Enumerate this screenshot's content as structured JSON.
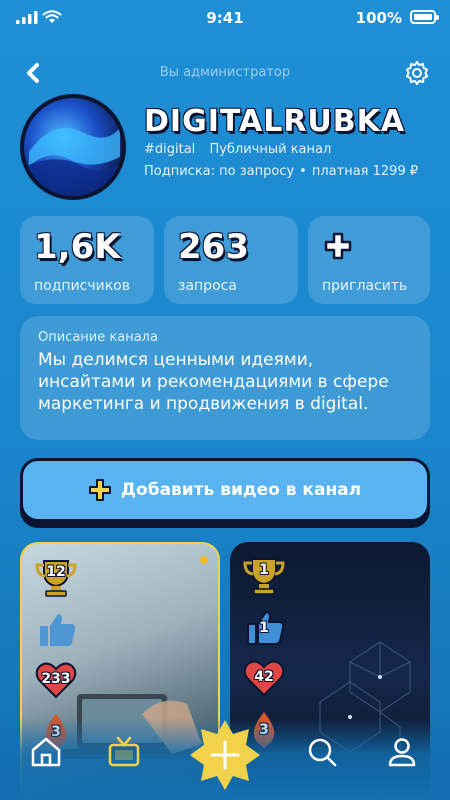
{
  "status": {
    "time": "9:41",
    "battery": "100%"
  },
  "header": {
    "admin_label": "Вы администратор"
  },
  "channel": {
    "name": "DIGITALRUBKA",
    "tag": "#digital",
    "type": "Публичный канал",
    "subscription_label": "Подписка:",
    "subscription_mode": "по запросу",
    "paid_label": "платная",
    "price": "1299 ₽"
  },
  "stats": [
    {
      "value": "1,6K",
      "label": "подписчиков"
    },
    {
      "value": "263",
      "label": "запроса"
    },
    {
      "value": "+",
      "label": "пригласить"
    }
  ],
  "description": {
    "title": "Описание канала",
    "text": "Мы делимся ценными идеями, инсайтами и рекомендациями в сфере маркетинга и продвижения в digital."
  },
  "add_video": {
    "label": "Добавить видео в канал"
  },
  "videos": [
    {
      "trophy": "12",
      "likes": "",
      "hearts": "233",
      "fire": "3"
    },
    {
      "trophy": "1",
      "likes": "1",
      "hearts": "42",
      "fire": "3"
    }
  ],
  "icons": {
    "back": "back-arrow-icon",
    "settings": "gear-icon",
    "home": "home-icon",
    "tv": "tv-icon",
    "add": "plus-star-icon",
    "search": "search-icon",
    "profile": "profile-icon"
  },
  "colors": {
    "accent": "#f2d24a",
    "background": "#1f8fd6",
    "dark": "#0b1430",
    "button": "#59b3f0",
    "heart": "#e04646"
  }
}
